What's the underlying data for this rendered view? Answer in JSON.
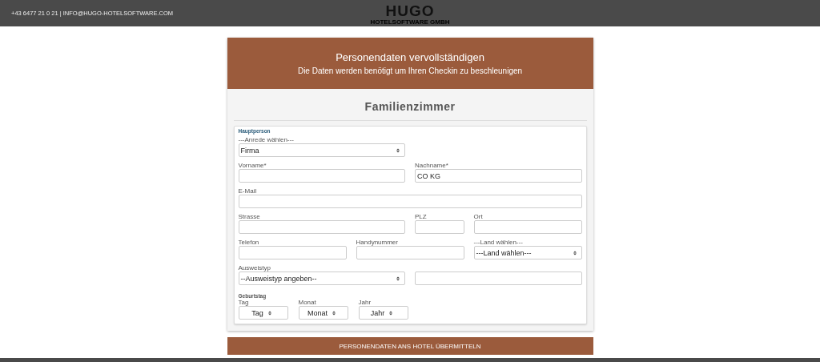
{
  "topbar": {
    "contact": "+43 6477 21 0 21 | INFO@HUGO-HOTELSOFTWARE.COM",
    "logo": "HUGO",
    "logo_sub": "HOTELSOFTWARE GMBH"
  },
  "banner": {
    "title": "Personendaten vervollständigen",
    "subtitle": "Die Daten werden benötigt um Ihren Checkin zu beschleunigen"
  },
  "room_title": "Familienzimmer",
  "section": "Hauptperson",
  "rows": [
    [
      {
        "kind": "select",
        "label": "---Anrede wählen---",
        "value": "Firma"
      }
    ],
    [
      {
        "kind": "input",
        "label": "Vorname*"
      },
      {
        "kind": "input",
        "label": "Nachname*",
        "value": "CO KG"
      }
    ],
    [
      {
        "kind": "input",
        "label": "E-Mail"
      }
    ],
    [
      {
        "kind": "input",
        "label": "Strasse"
      },
      {
        "kind": "input",
        "label": "PLZ"
      },
      {
        "kind": "input",
        "label": "Ort"
      }
    ],
    [
      {
        "kind": "input",
        "label": "Telefon"
      },
      {
        "kind": "input",
        "label": "Handynummer"
      },
      {
        "kind": "select",
        "label": "---Land wählen---",
        "value": "---Land wählen---"
      }
    ],
    [
      {
        "kind": "select",
        "label": "Ausweistyp",
        "value": "--Ausweistyp angeben--"
      },
      {
        "kind": "input"
      }
    ]
  ],
  "birthday": {
    "title": "Geburtstag",
    "fields": [
      {
        "kind": "select",
        "label": "Tag",
        "value": "Tag"
      },
      {
        "kind": "select",
        "label": "Monat",
        "value": "Monat"
      },
      {
        "kind": "select",
        "label": "Jahr",
        "value": "Jahr"
      }
    ]
  },
  "submit": "PERSONENDATEN ANS HOTEL ÜBERMITTELN"
}
